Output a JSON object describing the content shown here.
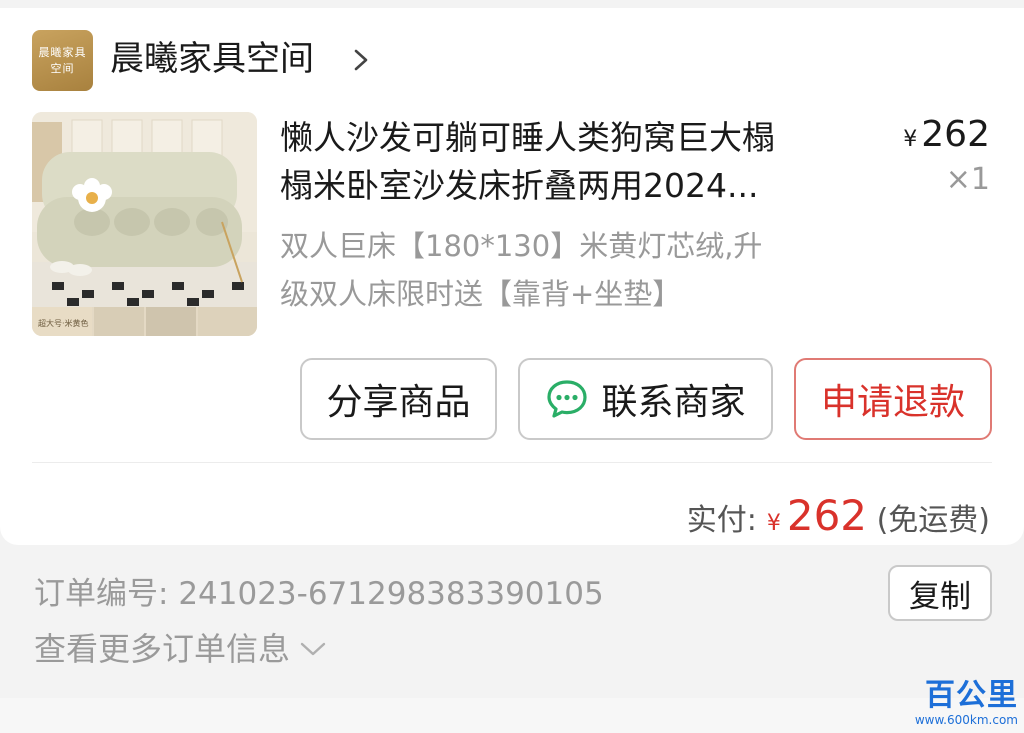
{
  "shop": {
    "logo_line1": "晨曦家具",
    "logo_line2": "空间",
    "name": "晨曦家具空间"
  },
  "product": {
    "title_line1": "懒人沙发可躺可睡人类狗窝巨大榻",
    "title_line2": "榻米卧室沙发床折叠两用2024...",
    "sku_line1": "双人巨床【180*130】米黄灯芯绒,升",
    "sku_line2": "级双人床限时送【靠背+坐垫】",
    "thumb_caption": "超大号·米黄色",
    "price_symbol": "¥",
    "price": "262",
    "quantity": "×1"
  },
  "actions": {
    "share_label": "分享商品",
    "contact_label": "联系商家",
    "refund_label": "申请退款"
  },
  "payment": {
    "label": "实付:",
    "symbol": "¥",
    "amount": "262",
    "note": "(免运费)"
  },
  "order": {
    "number_label": "订单编号:",
    "number": "241023-671298383390105",
    "copy_label": "复制",
    "more_label": "查看更多订单信息"
  },
  "watermark": {
    "text": "百公里",
    "url": "www.600km.com"
  },
  "colors": {
    "accent_red": "#d9322b",
    "wechat_green": "#2aae67",
    "shop_gold": "#b8914d"
  }
}
